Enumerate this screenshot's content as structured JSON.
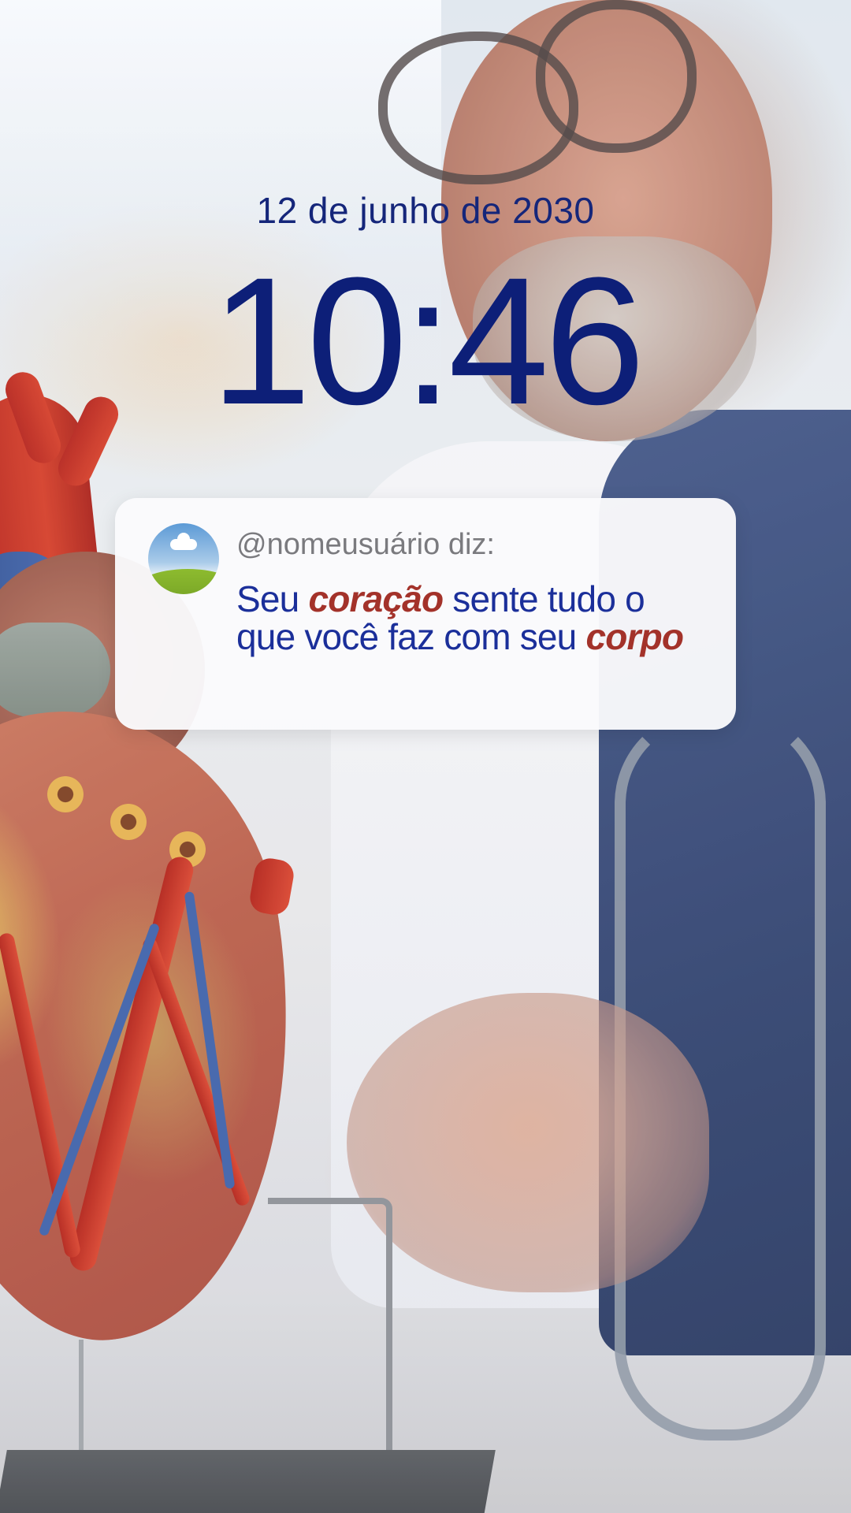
{
  "lock_screen": {
    "date": "12 de junho de 2030",
    "time": "10:46"
  },
  "notification": {
    "sender": "@nomeusuário diz:",
    "message": {
      "part1": "Seu ",
      "highlight1": "coração",
      "part2": " sente tudo o que você faz com seu ",
      "highlight2": "corpo"
    },
    "avatar_icon": "landscape-avatar-icon"
  },
  "colors": {
    "date_text": "#15267a",
    "clock_text": "#0d1f78",
    "message_text": "#1b2f9a",
    "highlight_text": "#a3322a",
    "sender_text": "#7a7a7e",
    "card_background": "#fafafc"
  },
  "wallpaper": {
    "description": ""
  }
}
